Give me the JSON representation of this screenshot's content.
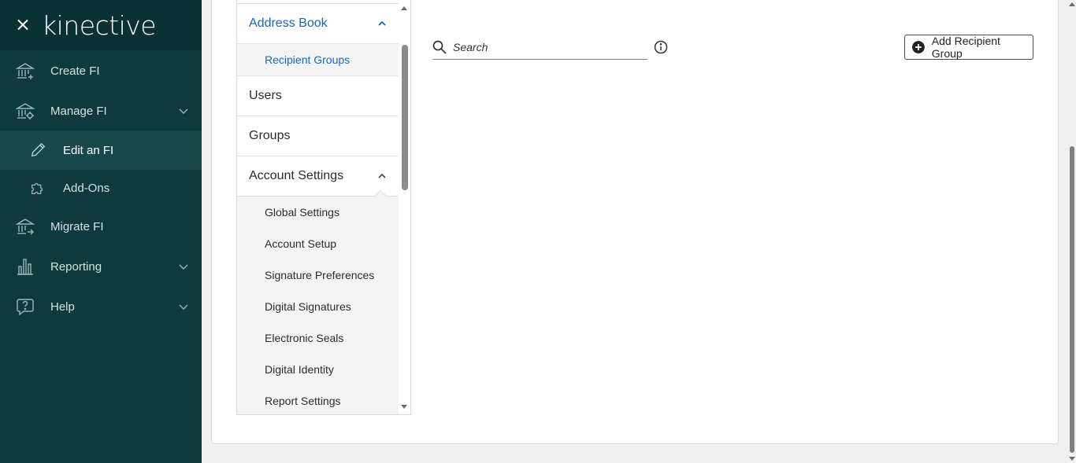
{
  "app": {
    "logo_text": "kinective"
  },
  "sidebar": {
    "items": [
      {
        "label": "Create FI",
        "icon": "bank-plus-icon"
      },
      {
        "label": "Manage FI",
        "icon": "bank-gear-icon",
        "expandable": true
      },
      {
        "label": "Edit an FI",
        "icon": "pencil-icon",
        "sub": true,
        "active": true
      },
      {
        "label": "Add-Ons",
        "icon": "puzzle-icon",
        "sub": true
      },
      {
        "label": "Migrate FI",
        "icon": "bank-arrow-icon"
      },
      {
        "label": "Reporting",
        "icon": "bar-chart-icon",
        "expandable": true
      },
      {
        "label": "Help",
        "icon": "help-bubble-icon",
        "expandable": true
      }
    ]
  },
  "settings_nav": {
    "address_book": "Address Book",
    "recipient_groups": "Recipient Groups",
    "users": "Users",
    "groups": "Groups",
    "account_settings": "Account Settings",
    "account_sub": [
      "Global Settings",
      "Account Setup",
      "Signature Preferences",
      "Digital Signatures",
      "Electronic Seals",
      "Digital Identity",
      "Report Settings"
    ]
  },
  "search": {
    "placeholder": "Search",
    "value": ""
  },
  "actions": {
    "add_recipient_group": "Add Recipient Group"
  },
  "colors": {
    "sidebar_bg": "#0d3a3c",
    "sidebar_active_bg": "#17494b",
    "link_blue": "#1a67b8"
  }
}
